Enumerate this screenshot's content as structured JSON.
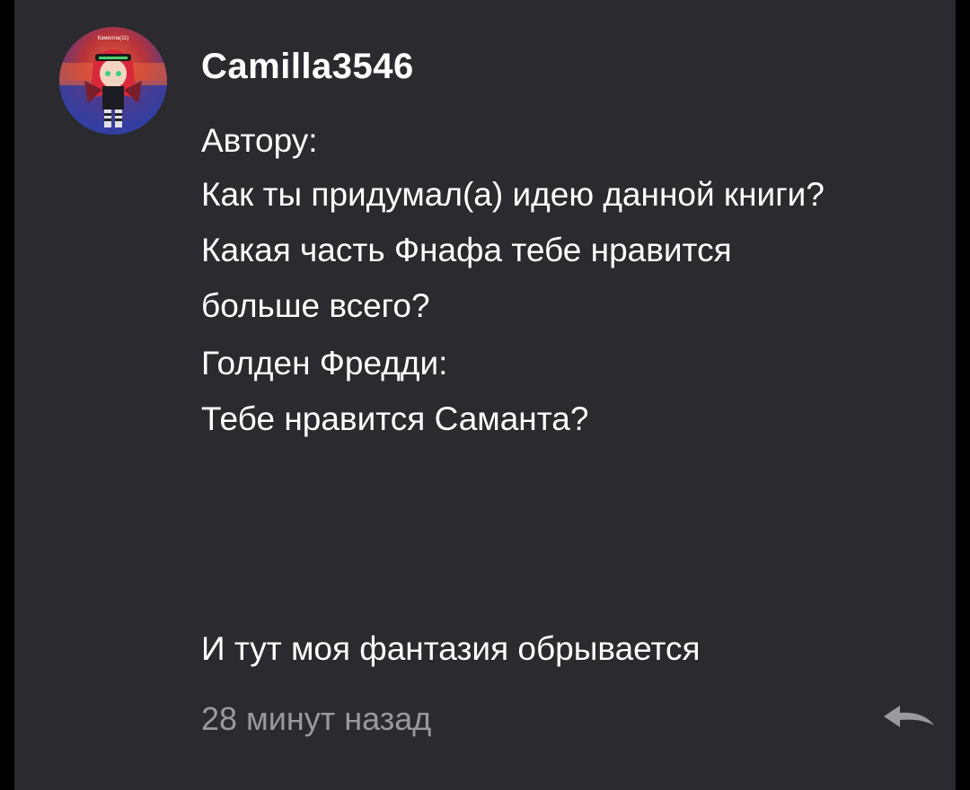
{
  "comment": {
    "avatar": {
      "label": "Камилла(11)",
      "icon": "user-avatar-image"
    },
    "username": "Camilla3546",
    "lines": [
      "Автору:",
      "Как ты придумал(а) идею данной книги?",
      "Какая часть Фнафа тебе нравится",
      "больше всего?",
      "Голден Фредди:",
      "Тебе нравится Саманта?"
    ],
    "final_line": "И тут моя фантазия обрывается",
    "timestamp": "28 минут назад",
    "reply_icon": "reply-arrow-icon"
  },
  "colors": {
    "background": "#2b2a2e",
    "text": "#ffffff",
    "muted": "#9a999e"
  }
}
